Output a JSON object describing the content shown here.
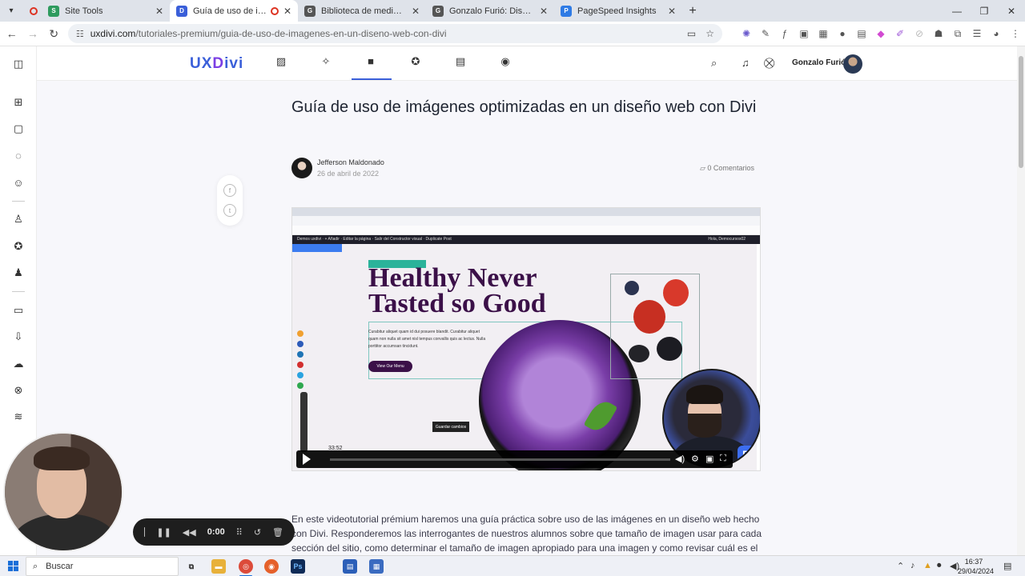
{
  "browser": {
    "tabs": [
      {
        "title": "Site Tools",
        "active": false
      },
      {
        "title": "Guía de uso de imágenes optimizadas",
        "active": true
      },
      {
        "title": "Biblioteca de medios < Diseñador web",
        "active": false
      },
      {
        "title": "Gonzalo Furió: Diseñador web",
        "active": false
      },
      {
        "title": "PageSpeed Insights",
        "active": false
      }
    ],
    "url_host": "uxdivi.com",
    "url_path": "/tutoriales-premium/guia-de-uso-de-imagenes-en-un-diseno-web-con-divi"
  },
  "site": {
    "logo_ux": "UX",
    "logo_d": "D",
    "logo_ivi": "ivi",
    "user_name": "Gonzalo Furió"
  },
  "article": {
    "title": "Guía de uso de imágenes optimizadas en un diseño web con Divi",
    "author": "Jefferson Maldonado",
    "date": "26 de abril de 2022",
    "comments": "0 Comentarios",
    "description": "En este videotutorial prémium haremos una guía práctica sobre uso de las imágenes en un diseño web hecho con Divi. Responderemos las interrogantes de nuestros alumnos sobre que tamaño de imagen usar para cada sección del sitio, como determinar el tamaño de imagen apropiado para una imagen y como revisar cuál es el tamaño de imágenes que"
  },
  "video": {
    "divi_bar_left": "Demos uxdivi  ·  +  Añadir  ·  Editar la página  ·  Salir del Constructor visual  ·  Duplicate Post",
    "divi_bar_right": "Hola, Democursos02",
    "heading_line1": "Healthy Never",
    "heading_line2": "Tasted so Good",
    "body": "Curabitur aliquet quam id dui posuere blandit. Curabitur aliquet quam non nulla sit amet nisl tempus convallis quis ac lectus. Nulla porttitor accumsan tincidunt.",
    "button": "View Our Menu",
    "save_label": "Guardar cambios",
    "time_tooltip": "33:52",
    "progress": 0.0
  },
  "recorder": {
    "time": "0:00"
  },
  "taskbar": {
    "search": "Buscar",
    "time": "16:37",
    "date": "29/04/2024"
  },
  "colors": {
    "accent": "#3a5fd9",
    "video_heading": "#3b1048",
    "progress": "#8a3cf0"
  }
}
